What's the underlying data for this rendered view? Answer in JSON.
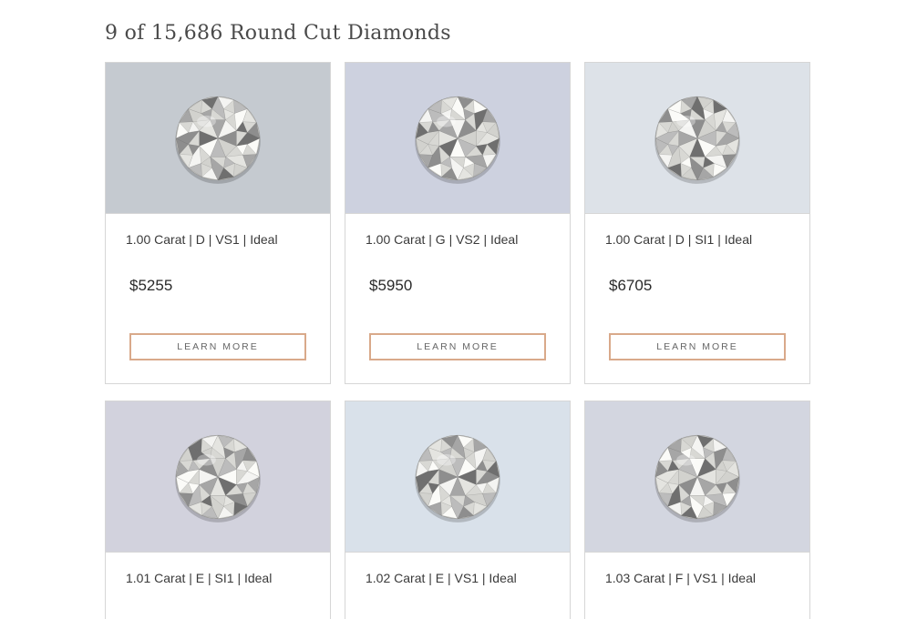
{
  "listing": {
    "heading": "9 of 15,686 Round Cut Diamonds"
  },
  "colors": {
    "button_border": "#d9a98a",
    "card_border": "#d6d6d6"
  },
  "cards": [
    {
      "spec": "1.00 Carat | D | VS1 | Ideal",
      "price": "$5255",
      "button_label": "LEARN MORE",
      "image_bg": "#c5cad0",
      "icon": "round-diamond-image"
    },
    {
      "spec": "1.00 Carat | G | VS2 | Ideal",
      "price": "$5950",
      "button_label": "LEARN MORE",
      "image_bg": "#cdd1df",
      "icon": "round-diamond-image"
    },
    {
      "spec": "1.00 Carat | D | SI1 | Ideal",
      "price": "$6705",
      "button_label": "LEARN MORE",
      "image_bg": "#dde2e8",
      "icon": "round-diamond-image"
    },
    {
      "spec": "1.01 Carat | E | SI1 | Ideal",
      "image_bg": "#d2d2dd",
      "icon": "round-diamond-image"
    },
    {
      "spec": "1.02 Carat | E | VS1 | Ideal",
      "image_bg": "#d9e1ea",
      "icon": "round-diamond-image"
    },
    {
      "spec": "1.03 Carat | F | VS1 | Ideal",
      "image_bg": "#d3d6e0",
      "icon": "round-diamond-image"
    }
  ]
}
